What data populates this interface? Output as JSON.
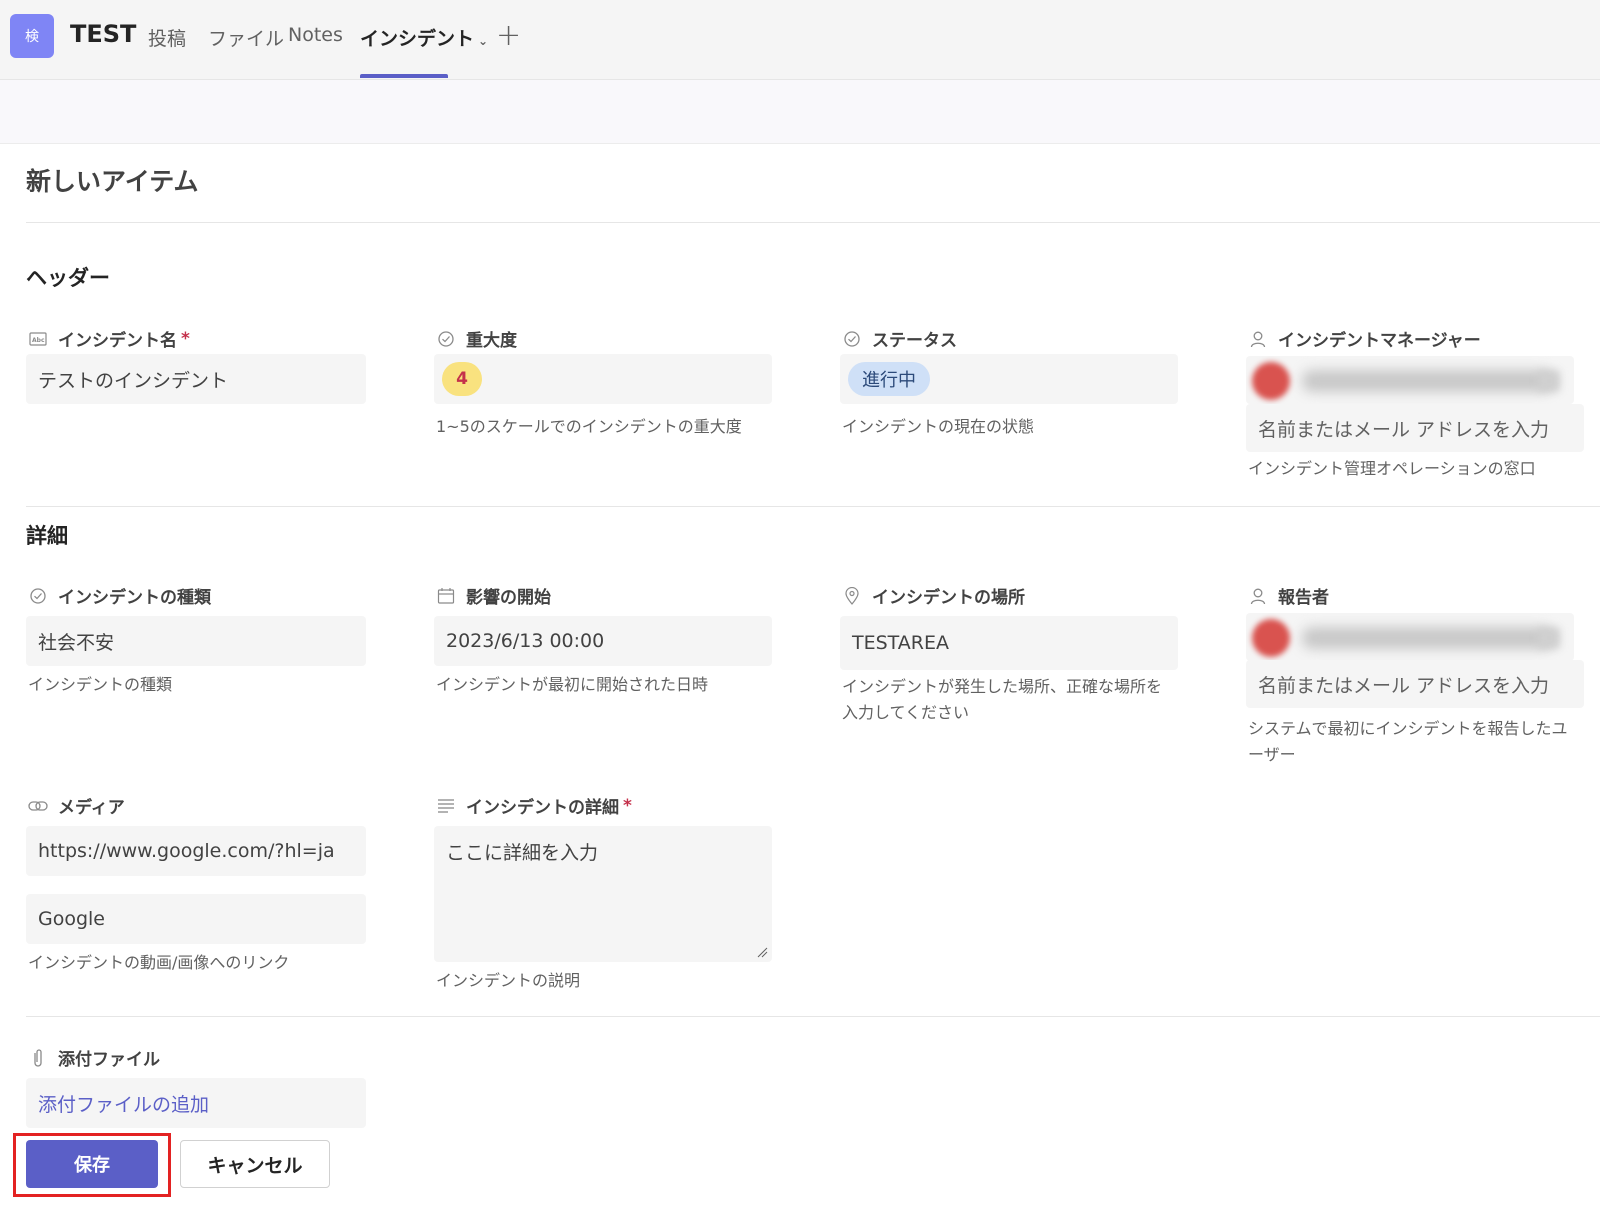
{
  "header": {
    "app_badge": "検",
    "team_name": "TEST",
    "tabs": [
      {
        "label": "投稿"
      },
      {
        "label": "ファイル"
      },
      {
        "label": "Notes"
      },
      {
        "label": "インシデント"
      }
    ],
    "active_tab": "インシデント"
  },
  "form": {
    "title": "新しいアイテム",
    "sections": {
      "header_title": "ヘッダー",
      "details_title": "詳細"
    },
    "fields": {
      "incident_name": {
        "label": "インシデント名",
        "required_mark": "*",
        "value": "テストのインシデント"
      },
      "severity": {
        "label": "重大度",
        "value": "4",
        "helper": "1~5のスケールでのインシデントの重大度"
      },
      "status": {
        "label": "ステータス",
        "value": "進行中",
        "helper": "インシデントの現在の状態"
      },
      "incident_manager": {
        "label": "インシデントマネージャー",
        "placeholder": "名前またはメール アドレスを入力",
        "helper": "インシデント管理オペレーションの窓口"
      },
      "incident_type": {
        "label": "インシデントの種類",
        "value": "社会不安",
        "helper": "インシデントの種類"
      },
      "impact_start": {
        "label": "影響の開始",
        "value": "2023/6/13 00:00",
        "helper": "インシデントが最初に開始された日時"
      },
      "incident_location": {
        "label": "インシデントの場所",
        "value": "TESTAREA",
        "helper_line1": "インシデントが発生した場所、正確な場所を",
        "helper_line2": "入力してください"
      },
      "reporter": {
        "label": "報告者",
        "placeholder": "名前またはメール アドレスを入力",
        "helper_line1": "システムで最初にインシデントを報告したユ",
        "helper_line2": "ーザー"
      },
      "media": {
        "label": "メディア",
        "url_value": "https://www.google.com/?hl=ja",
        "text_value": "Google",
        "helper": "インシデントの動画/画像へのリンク"
      },
      "incident_details": {
        "label": "インシデントの詳細",
        "required_mark": "*",
        "placeholder": "ここに詳細を入力",
        "helper": "インシデントの説明"
      },
      "attachments": {
        "label": "添付ファイル",
        "add_link": "添付ファイルの追加"
      }
    },
    "buttons": {
      "save": "保存",
      "cancel": "キャンセル"
    }
  },
  "colors": {
    "accent": "#5b5fc7",
    "severity_pill": "#f9e27f",
    "status_pill": "#cfe0f7",
    "highlight_box": "#e32222"
  }
}
